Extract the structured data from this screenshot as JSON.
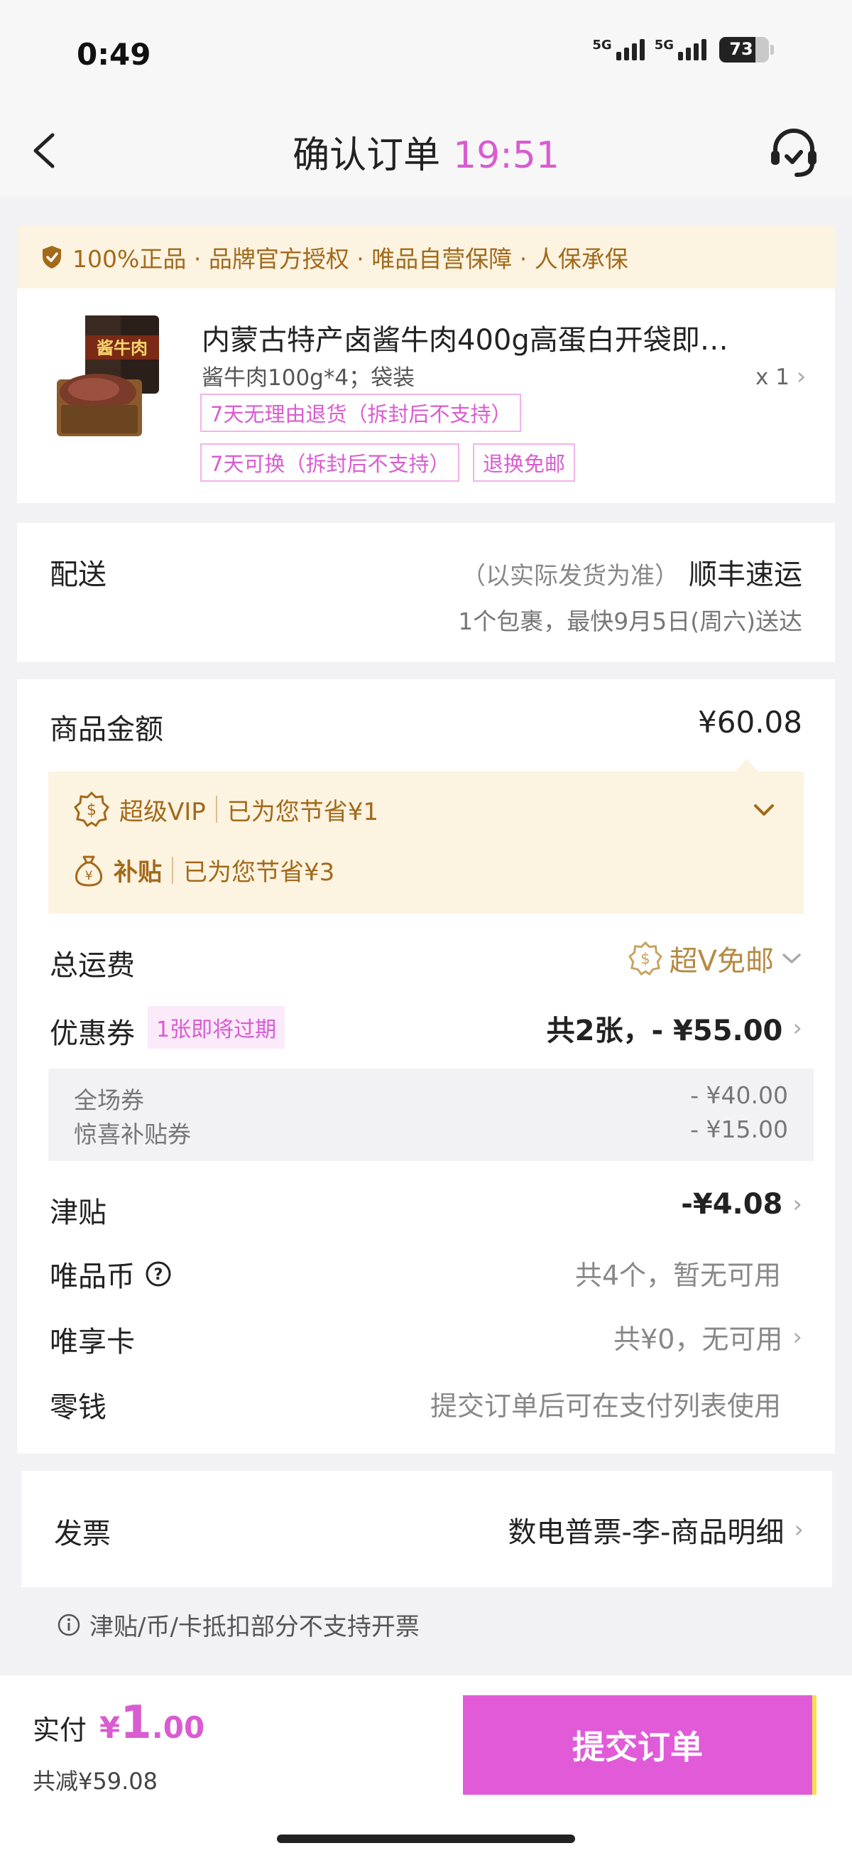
{
  "status_bar": {
    "time": "0:49",
    "network1": "5G",
    "network2": "5G",
    "battery": "73",
    "battery_level": 0.73
  },
  "header": {
    "title": "确认订单",
    "timer": "19:51"
  },
  "guarantee": {
    "text": "100%正品 · 品牌官方授权 · 唯品自营保障 · 人保承保"
  },
  "product": {
    "image_text": "酱牛肉",
    "title": "内蒙古特产卤酱牛肉400g高蛋白开袋即…",
    "spec": "酱牛肉100g*4；袋装",
    "quantity": "x 1",
    "tags": [
      "7天无理由退货（拆封后不支持）",
      "7天可换（拆封后不支持）",
      "退换免邮"
    ]
  },
  "delivery": {
    "label": "配送",
    "note": "（以实际发货为准）",
    "carrier": "顺丰速运",
    "eta": "1个包裹，最快9月5日(周六)送达"
  },
  "summary": {
    "goods_label": "商品金额",
    "goods_amount": "¥60.08",
    "vip_label": "超级VIP",
    "vip_saving": "已为您节省¥1",
    "subsidy_label": "补贴",
    "subsidy_saving": "已为您节省¥3",
    "shipping_label": "总运费",
    "shipping_value": "超V免邮",
    "coupon_label": "优惠券",
    "coupon_badge": "1张即将过期",
    "coupon_value": "共2张，- ¥55.00",
    "coupons": [
      {
        "name": "全场券",
        "amount": "- ¥40.00"
      },
      {
        "name": "惊喜补贴券",
        "amount": "- ¥15.00"
      }
    ],
    "allowance_label": "津贴",
    "allowance_value": "-¥4.08",
    "coin_label": "唯品币",
    "coin_value": "共4个，暂无可用",
    "card_label": "唯享卡",
    "card_value": "共¥0，无可用",
    "change_label": "零钱",
    "change_value": "提交订单后可在支付列表使用"
  },
  "invoice": {
    "label": "发票",
    "value": "数电普票-李-商品明细"
  },
  "note": "津贴/币/卡抵扣部分不支持开票",
  "footer": {
    "pay_label": "实付",
    "currency": "¥",
    "amount_int": "1",
    "amount_dec": ".00",
    "saved": "共减¥59.08",
    "submit": "提交订单"
  },
  "colors": {
    "accent": "#e15ad8",
    "gold": "#a26a1b",
    "vip_bg": "#fdf3e1"
  }
}
